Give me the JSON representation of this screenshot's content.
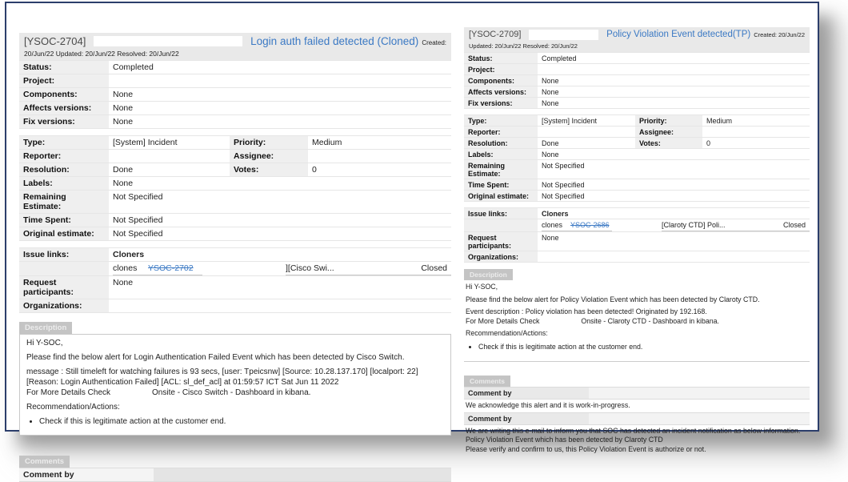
{
  "colors": {
    "link_blue": "#3b79c4",
    "label_bg": "#efefef",
    "header_bg": "#e9e9e9",
    "tab_bg": "#c4c4c4",
    "frame_navy": "#2c3e6b"
  },
  "left": {
    "key": "[YSOC-2704]",
    "title": "Login auth failed detected (Cloned)",
    "created_label": "Created:",
    "dates_line": "20/Jun/22  Updated: 20/Jun/22  Resolved: 20/Jun/22",
    "fields1": [
      {
        "label": "Status:",
        "value": "Completed"
      },
      {
        "label": "Project:",
        "value": ""
      },
      {
        "label": "Components:",
        "value": "None"
      },
      {
        "label": "Affects versions:",
        "value": "None"
      },
      {
        "label": "Fix versions:",
        "value": "None"
      }
    ],
    "fields2": [
      {
        "l1": "Type:",
        "v1": "[System] Incident",
        "l2": "Priority:",
        "v2": "Medium"
      },
      {
        "l1": "Reporter:",
        "v1": "",
        "l2": "Assignee:",
        "v2": ""
      },
      {
        "l1": "Resolution:",
        "v1": "Done",
        "l2": "Votes:",
        "v2": "0"
      }
    ],
    "fields3": [
      {
        "label": "Labels:",
        "value": "None"
      },
      {
        "label": "Remaining Estimate:",
        "value": "Not Specified"
      },
      {
        "label": "Time Spent:",
        "value": "Not Specified"
      },
      {
        "label": "Original estimate:",
        "value": "Not Specified"
      }
    ],
    "issue_links": {
      "label": "Issue links:",
      "group": "Cloners",
      "relation": "clones",
      "key": "YSOC-2702",
      "target": "][Cisco Swi...",
      "status": "Closed"
    },
    "request_participants": {
      "label": "Request participants:",
      "value": "None"
    },
    "organizations": {
      "label": "Organizations:",
      "value": ""
    },
    "description": {
      "tab": "Description",
      "greeting": "Hi Y-SOC,",
      "intro": "Please find the below alert for Login Authentication Failed Event which has been detected by Cisco Switch.",
      "message": "message : Still timeleft for watching failures is 93 secs, [user: Tpeicsnw] [Source: 10.28.137.170] [localport: 22] [Reason: Login Authentication Failed] [ACL: sl_def_acl] at 01:59:57 ICT Sat Jun 11 2022",
      "more_details_label": "For More Details Check",
      "more_details_value": "Onsite - Cisco Switch - Dashboard in kibana.",
      "recommendation_label": "Recommendation/Actions:",
      "recommendation_bullet": "Check if this is legitimate action at the customer end."
    },
    "comments": {
      "tab": "Comments",
      "items": [
        {
          "by": "Comment by"
        }
      ]
    }
  },
  "right": {
    "key": "[YSOC-2709]",
    "title": "Policy Violation Event detected(TP)",
    "created_label": "Created: 20/Jun/22",
    "dates_line": "Updated: 20/Jun/22  Resolved: 20/Jun/22",
    "fields1": [
      {
        "label": "Status:",
        "value": "Completed"
      },
      {
        "label": "Project:",
        "value": ""
      },
      {
        "label": "Components:",
        "value": "None"
      },
      {
        "label": "Affects versions:",
        "value": "None"
      },
      {
        "label": "Fix versions:",
        "value": "None"
      }
    ],
    "fields2": [
      {
        "l1": "Type:",
        "v1": "[System] Incident",
        "l2": "Priority:",
        "v2": "Medium"
      },
      {
        "l1": "Reporter:",
        "v1": "",
        "l2": "Assignee:",
        "v2": ""
      },
      {
        "l1": "Resolution:",
        "v1": "Done",
        "l2": "Votes:",
        "v2": "0"
      }
    ],
    "fields3": [
      {
        "label": "Labels:",
        "value": "None"
      },
      {
        "label": "Remaining Estimate:",
        "value": "Not Specified"
      },
      {
        "label": "Time Spent:",
        "value": "Not Specified"
      },
      {
        "label": "Original estimate:",
        "value": "Not Specified"
      }
    ],
    "issue_links": {
      "label": "Issue links:",
      "group": "Cloners",
      "relation": "clones",
      "key": "YSOC-2686",
      "target": "[Claroty CTD] Poli...",
      "status": "Closed"
    },
    "request_participants": {
      "label": "Request participants:",
      "value": "None"
    },
    "organizations": {
      "label": "Organizations:",
      "value": ""
    },
    "description": {
      "tab": "Description",
      "greeting": "Hi Y-SOC,",
      "intro": "Please find the below alert for Policy Violation Event which has been detected by Claroty CTD.",
      "message": "Event description : Policy violation has been detected! Originated by 192.168.",
      "more_details_label": "For More Details Check",
      "more_details_value": "Onsite - Claroty CTD - Dashboard in kibana.",
      "recommendation_label": "Recommendation/Actions:",
      "recommendation_bullet": "Check if this is legitimate action at the customer end."
    },
    "comments": {
      "tab": "Comments",
      "items": [
        {
          "by": "Comment by",
          "line1": "We acknowledge this alert and it is work-in-progress."
        },
        {
          "by": "Comment by",
          "line1": "We are writing this e-mail to inform you that SOC has detected an incident notification as below information.",
          "line2": "Policy Violation Event which has been detected by Claroty CTD",
          "line3": "Please verify and confirm to us, this Policy Violation Event is authorize or not."
        }
      ]
    }
  }
}
